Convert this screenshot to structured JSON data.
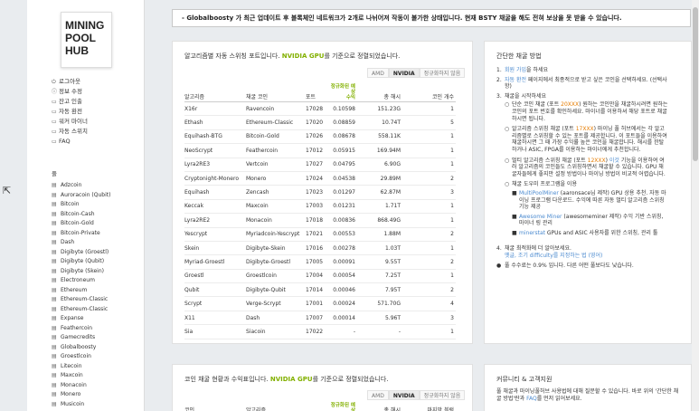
{
  "brand": {
    "line1": "MINING",
    "line2": "POOL",
    "line3": "HUB"
  },
  "menu": [
    {
      "icon": "⏻",
      "label": "로그아웃"
    },
    {
      "icon": "ⓘ",
      "label": "정보 수정"
    },
    {
      "icon": "▭",
      "label": "잔고 인출"
    },
    {
      "icon": "▭",
      "label": "자동 환전"
    },
    {
      "icon": "▭",
      "label": "워커 마이너"
    },
    {
      "icon": "▭",
      "label": "자동 스위치"
    },
    {
      "icon": "▭",
      "label": "FAQ"
    }
  ],
  "coins_section": "풀",
  "coins": [
    "Adzcoin",
    "Auroracoin (Qubit)",
    "Bitcoin",
    "Bitcoin-Cash",
    "Bitcoin-Gold",
    "Bitcoin-Private",
    "Dash",
    "Digibyte (Groestl)",
    "Digibyte (Qubit)",
    "Digibyte (Skein)",
    "Electroneum",
    "Ethereum",
    "Ethereum-Classic",
    "Ethereum-Classic",
    "Expanse",
    "Feathercoin",
    "Gamecredits",
    "Globalboosty",
    "Groestlcoin",
    "Litecoin",
    "Maxcoin",
    "Monacoin",
    "Monero",
    "Musicoin"
  ],
  "notice": "- Globalboosty 가 최근 업데이트 후 블록체인 네트워크가 2개로 나뉘어져 작동이 불가한 상태입니다. 현재 BSTY 채굴을 해도 전혀 보상을 못 받을 수 있습니다.",
  "algo_card": {
    "title_pre": "알고리즘별 자동 스위칭 포트입니다. ",
    "title_hl": "NVIDIA GPU",
    "title_post": "를 기준으로 정렬되었습니다.",
    "buttons": [
      "AMD",
      "NVIDIA",
      "정규화하지 않음"
    ],
    "headers": {
      "algo": "알고리즘",
      "coin": "채굴 코인",
      "port": "포트",
      "profit_a": "정규화된 예상",
      "profit_b": "수익",
      "hashrate": "총 해시",
      "count": "코인 개수"
    },
    "rows": [
      [
        "X16r",
        "Ravencoin",
        "17028",
        "0.10598",
        "151.23G",
        "1"
      ],
      [
        "Ethash",
        "Ethereum-Classic",
        "17020",
        "0.08859",
        "10.74T",
        "5"
      ],
      [
        "Equihash-BTG",
        "Bitcoin-Gold",
        "17026",
        "0.08678",
        "558.11K",
        "1"
      ],
      [
        "NeoScrypt",
        "Feathercoin",
        "17012",
        "0.05915",
        "169.94M",
        "1"
      ],
      [
        "Lyra2RE3",
        "Vertcoin",
        "17027",
        "0.04795",
        "6.90G",
        "1"
      ],
      [
        "Cryptonight-Monero",
        "Monero",
        "17024",
        "0.04538",
        "29.89M",
        "2"
      ],
      [
        "Equihash",
        "Zencash",
        "17023",
        "0.01297",
        "62.87M",
        "3"
      ],
      [
        "Keccak",
        "Maxcoin",
        "17003",
        "0.01231",
        "1.71T",
        "1"
      ],
      [
        "Lyra2RE2",
        "Monacoin",
        "17018",
        "0.00836",
        "868.49G",
        "1"
      ],
      [
        "Yescrypt",
        "Myriadcoin-Yescrypt",
        "17021",
        "0.00553",
        "1.88M",
        "2"
      ],
      [
        "Skein",
        "Digibyte-Skein",
        "17016",
        "0.00278",
        "1.03T",
        "1"
      ],
      [
        "Myriad-Groestl",
        "Digibyte-Groestl",
        "17005",
        "0.00091",
        "9.55T",
        "2"
      ],
      [
        "Groestl",
        "Groestlcoin",
        "17004",
        "0.00054",
        "7.25T",
        "1"
      ],
      [
        "Qubit",
        "Digibyte-Qubit",
        "17014",
        "0.00046",
        "7.95T",
        "2"
      ],
      [
        "Scrypt",
        "Verge-Scrypt",
        "17001",
        "0.00024",
        "571.70G",
        "4"
      ],
      [
        "X11",
        "Dash",
        "17007",
        "0.00014",
        "5.96T",
        "3"
      ],
      [
        "Sia",
        "Siacoin",
        "17022",
        "-",
        "-",
        "1"
      ]
    ]
  },
  "coin_card": {
    "title_pre": "코인 채굴 현황과 수익표입니다. ",
    "title_hl": "NVIDIA GPU",
    "title_post": "를 기준으로 정렬되었습니다.",
    "buttons": [
      "AMD",
      "NVIDIA",
      "정규화하지 않음"
    ],
    "headers": {
      "coin": "코인",
      "algo": "알고리즘",
      "profit_a": "정규화된 예상",
      "hashrate": "총 해시",
      "block": "마지막 블럭"
    }
  },
  "guide_card": {
    "title": "간단한 채굴 방법",
    "s1_link": "회원 가입",
    "s1_post": "을 하세요",
    "s2_link": "자동 환전",
    "s2_post": " 페이지에서 최종적으로 받고 싶은 코인을 선택하세요. (선택사항)",
    "s3": "채굴을 시작하세요",
    "b1_pre": "단순 코인 채굴 (포트 ",
    "b1_hl": "20XXX",
    "b1_post": ") 원하는 코인만을 채굴하시려면 원하는 코인의 포트 번호를 확인하세요. 마이너를 이용하셔 해당 포트로 채굴하시면 됩니다.",
    "b2_pre": "알고리즘 스위칭 채굴 (포트 ",
    "b2_hl": "17XXX",
    "b2_post": ") 마이닝 풀 허브에서는 각 알고리즘별로 스위칭할 수 있는 포트를 제공합니다. 이 포트들을 이용하여 채굴하시면 그 때 가장 수익률 높은 코인을 채굴합니다. 해시를 한탈하거나 ASIC, FPGA를 이용하는 마이너에게 추천합니다.",
    "b3_pre": "멀티 알고리즘 스위칭 채굴 (포트 ",
    "b3_hl": "12XXX",
    "b3_link": "이것",
    "b3_post": " 기능을 이용하여 여러 알고리즘의 코인들도 스위칭하면서 채굴할 수 있습니다. GPU 채굴자들에게 좋지만 설정 방법이나 마이닝 방법이 비교적 어렵습니다.",
    "b4": "채굴 도우미 프로그램을 이용",
    "t1_link": "MultiPoolMiner",
    "t1_post": " (aaronsace님 제작) GPU 상용 추천. 자동 마이닝 프로그램 다운로드. 수익에 따른 자동 멀티 알고리즘 스위칭 기능 제공",
    "t2_link": "Awesome Miner",
    "t2_post": " (awesomeminer 제작) 수익 기반 스위칭, 마이너 링 관리",
    "t3_link": "minerstat",
    "t3_post": " GPUs and ASIC 사용자를 위한 스위칭, 관리 툴",
    "s4": "채굴 최적화에 더 알아보세요.",
    "s4_link": "옛글, 조기 difficulty를 지정하는 법 (영어)",
    "fee": "풀 수수료는 0.9% 입니다. 다른 어떤 풀보다도 낮습니다."
  },
  "community_card": {
    "title": "커뮤니티 & 고객지원",
    "text_pre": "풀 채굴과 마이닝풀허브 사용법에 대해 질문할 수 있습니다. 바로 위의 '간단한 채굴 방법'란과 ",
    "text_link": "FAQ",
    "text_post": "를 먼저 읽어보세요."
  }
}
